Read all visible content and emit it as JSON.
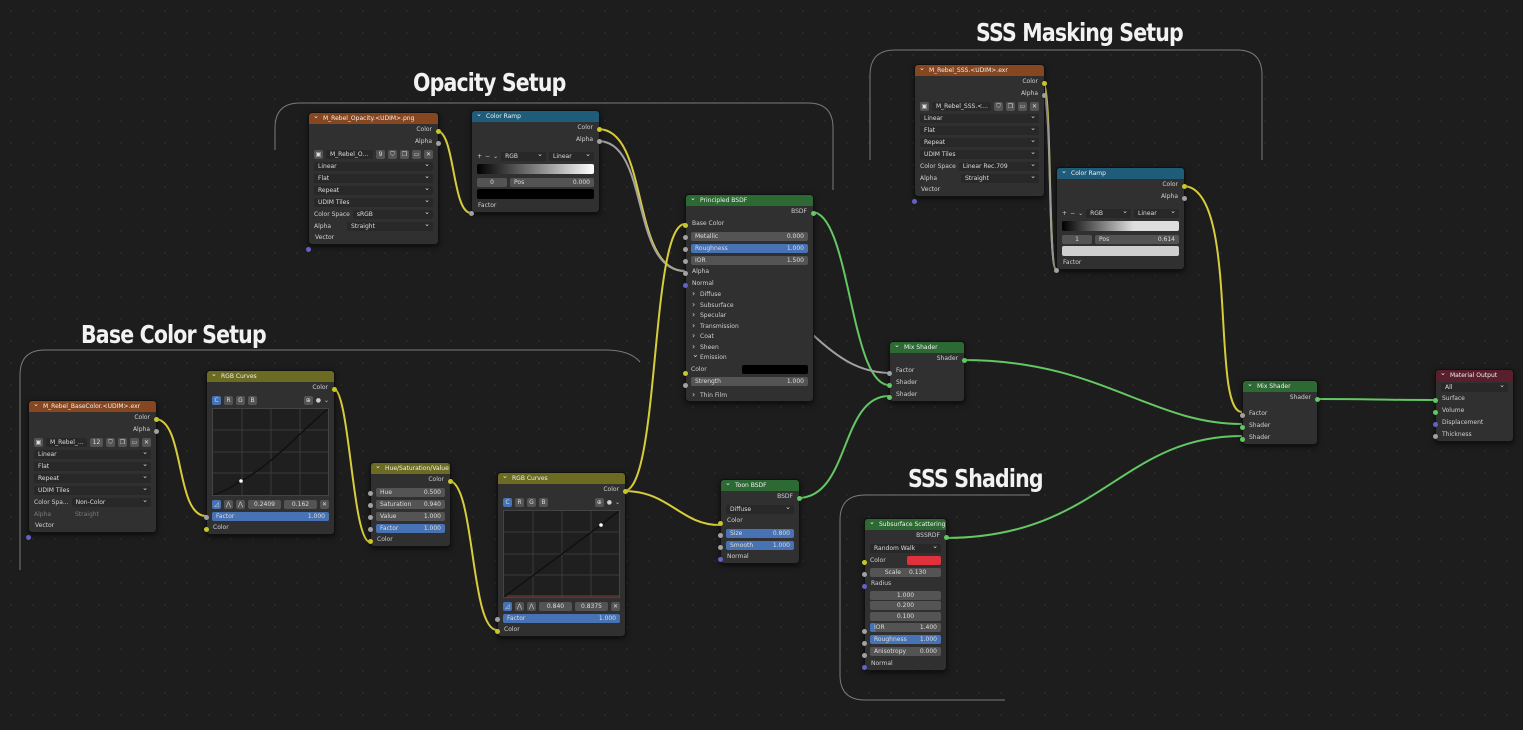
{
  "frames": {
    "opacity": "Opacity Setup",
    "sss_mask": "SSS Masking Setup",
    "base_color": "Base Color Setup",
    "sss_shading": "SSS Shading"
  },
  "colors": {
    "link_color": "#d7cc3c",
    "link_shader": "#63c763",
    "link_float": "#a1a1a1",
    "socket_color": "#c7c729",
    "socket_float": "#a1a1a1",
    "socket_shader": "#63c763",
    "socket_vector": "#6363c7",
    "sss_color": "#e0313d"
  },
  "opacity_tex": {
    "title": "M_Rebel_Opacity.<UDIM>.png",
    "out_color": "Color",
    "out_alpha": "Alpha",
    "image_name": "M_Rebel_O...",
    "users": "9",
    "interpolation": "Linear",
    "projection": "Flat",
    "extension": "Repeat",
    "source": "UDIM Tiles",
    "colorspace_label": "Color Space",
    "colorspace": "sRGB",
    "alpha_label": "Alpha",
    "alpha": "Straight",
    "in_vector": "Vector"
  },
  "opacity_ramp": {
    "title": "Color Ramp",
    "out_color": "Color",
    "out_alpha": "Alpha",
    "mode": "RGB",
    "interp": "Linear",
    "index": "0",
    "pos_label": "Pos",
    "pos": "0.000",
    "in_factor": "Factor"
  },
  "principled": {
    "title": "Principled BSDF",
    "out": "BSDF",
    "base_color": "Base Color",
    "metallic_label": "Metallic",
    "metallic": "0.000",
    "roughness_label": "Roughness",
    "roughness": "1.000",
    "ior_label": "IOR",
    "ior": "1.500",
    "alpha": "Alpha",
    "normal": "Normal",
    "panels": [
      "Diffuse",
      "Subsurface",
      "Specular",
      "Transmission",
      "Coat",
      "Sheen"
    ],
    "emission": "Emission",
    "em_color": "Color",
    "strength_label": "Strength",
    "strength": "1.000",
    "thin_film": "Thin Film"
  },
  "sss_tex": {
    "title": "M_Rebel_SSS.<UDIM>.exr",
    "out_color": "Color",
    "out_alpha": "Alpha",
    "image_name": "M_Rebel_SSS.<...",
    "interpolation": "Linear",
    "projection": "Flat",
    "extension": "Repeat",
    "source": "UDIM Tiles",
    "colorspace_label": "Color Space",
    "colorspace": "Linear Rec.709",
    "alpha_label": "Alpha",
    "alpha": "Straight",
    "in_vector": "Vector"
  },
  "sss_ramp": {
    "title": "Color Ramp",
    "out_color": "Color",
    "out_alpha": "Alpha",
    "mode": "RGB",
    "interp": "Linear",
    "index": "1",
    "pos_label": "Pos",
    "pos": "0.614",
    "in_factor": "Factor"
  },
  "mix1": {
    "title": "Mix Shader",
    "out": "Shader",
    "factor": "Factor",
    "s1": "Shader",
    "s2": "Shader"
  },
  "mix2": {
    "title": "Mix Shader",
    "out": "Shader",
    "factor": "Factor",
    "s1": "Shader",
    "s2": "Shader"
  },
  "output": {
    "title": "Material Output",
    "target": "All",
    "surface": "Surface",
    "volume": "Volume",
    "displacement": "Displacement",
    "thickness": "Thickness"
  },
  "base_tex": {
    "title": "M_Rebel_BaseColor.<UDIM>.exr",
    "out_color": "Color",
    "out_alpha": "Alpha",
    "image_name": "M_Rebel_...",
    "users": "12",
    "interpolation": "Linear",
    "projection": "Flat",
    "extension": "Repeat",
    "source": "UDIM Tiles",
    "colorspace_label": "Color Spa...",
    "colorspace": "Non-Color",
    "alpha_label": "Alpha",
    "alpha": "Straight",
    "in_vector": "Vector"
  },
  "curves1": {
    "title": "RGB Curves",
    "out": "Color",
    "channels": [
      "C",
      "R",
      "G",
      "B"
    ],
    "x": "0.2409",
    "y": "0.162",
    "factor_label": "Factor",
    "factor": "1.000",
    "in_color": "Color"
  },
  "hsv": {
    "title": "Hue/Saturation/Value",
    "out": "Color",
    "hue_label": "Hue",
    "hue": "0.500",
    "sat_label": "Saturation",
    "sat": "0.940",
    "val_label": "Value",
    "val": "1.000",
    "factor_label": "Factor",
    "factor": "1.000",
    "in_color": "Color"
  },
  "curves2": {
    "title": "RGB Curves",
    "out": "Color",
    "channels": [
      "C",
      "R",
      "G",
      "B"
    ],
    "x": "0.840",
    "y": "0.8375",
    "factor_label": "Factor",
    "factor": "1.000",
    "in_color": "Color"
  },
  "toon": {
    "title": "Toon BSDF",
    "out": "BSDF",
    "component": "Diffuse",
    "in_color": "Color",
    "size_label": "Size",
    "size": "0.800",
    "smooth_label": "Smooth",
    "smooth": "1.000",
    "normal": "Normal"
  },
  "sss": {
    "title": "Subsurface Scattering",
    "out": "BSSRDF",
    "method": "Random Walk",
    "color_label": "Color",
    "scale_label": "Scale",
    "scale": "0.130",
    "radius_label": "Radius",
    "radius": [
      "1.000",
      "0.200",
      "0.100"
    ],
    "ior_label": "IOR",
    "ior": "1.400",
    "roughness_label": "Roughness",
    "roughness": "1.000",
    "anisotropy_label": "Anisotropy",
    "anisotropy": "0.000",
    "normal": "Normal"
  }
}
